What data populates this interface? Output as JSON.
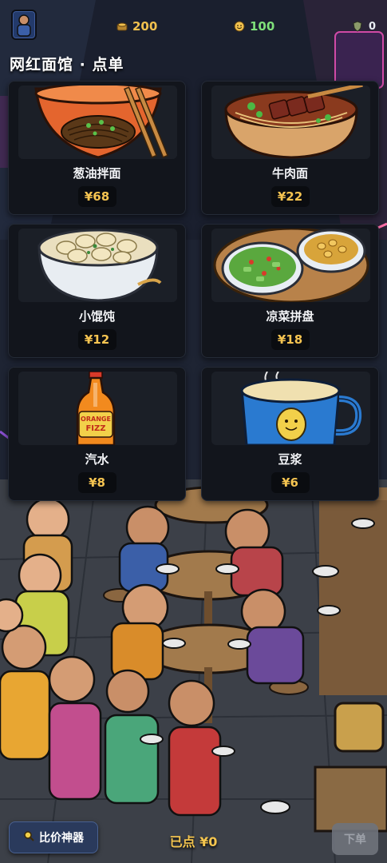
{
  "hud": {
    "money": "200",
    "reputation": "100",
    "shield": "0"
  },
  "page_title": "网红面馆 · 点单",
  "menu": [
    {
      "name": "葱油拌面",
      "price": "¥68",
      "icon": "scallion-oil-noodles-icon"
    },
    {
      "name": "牛肉面",
      "price": "¥22",
      "icon": "beef-noodles-icon"
    },
    {
      "name": "小馄饨",
      "price": "¥12",
      "icon": "wonton-soup-icon"
    },
    {
      "name": "凉菜拼盘",
      "price": "¥18",
      "icon": "cold-dish-platter-icon"
    },
    {
      "name": "汽水",
      "price": "¥8",
      "icon": "soda-bottle-icon",
      "bottle_label": "ORANGE FIZZ"
    },
    {
      "name": "豆浆",
      "price": "¥6",
      "icon": "soy-milk-mug-icon"
    }
  ],
  "bottom": {
    "compare_label": "比价神器",
    "ordered_total": "已点 ¥0",
    "submit_label": "下单"
  },
  "colors": {
    "money": "#f2c14e",
    "reputation": "#7fe07a",
    "price": "#f5c451",
    "card_bg": "#12151c"
  }
}
